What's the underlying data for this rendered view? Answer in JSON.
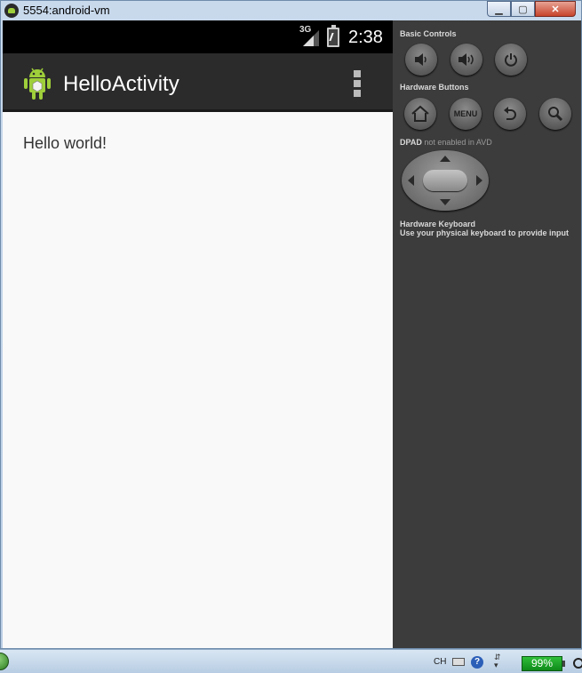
{
  "window": {
    "title": "5554:android-vm",
    "minimize_glyph": "▁",
    "maximize_glyph": "▢",
    "close_glyph": "✕"
  },
  "statusbar": {
    "network": "3G",
    "time": "2:38"
  },
  "actionbar": {
    "app_title": "HelloActivity",
    "app_icon": "android-robot-icon",
    "overflow_icon": "overflow-menu-icon"
  },
  "content": {
    "text": "Hello world!"
  },
  "panel": {
    "basic_controls_label": "Basic Controls",
    "basic_controls": [
      {
        "name": "volume-down",
        "glyph": "◀)"
      },
      {
        "name": "volume-up",
        "glyph": "◀))"
      },
      {
        "name": "power",
        "glyph": "⏻"
      }
    ],
    "hardware_buttons_label": "Hardware Buttons",
    "hardware_buttons": [
      {
        "name": "home",
        "glyph": "⌂"
      },
      {
        "name": "menu",
        "glyph": "MENU"
      },
      {
        "name": "back",
        "glyph": "↶"
      },
      {
        "name": "search",
        "glyph": "🔍"
      }
    ],
    "dpad_label": "DPAD",
    "dpad_note": "not enabled in AVD",
    "keyboard_label": "Hardware Keyboard",
    "keyboard_note": "Use your physical keyboard to provide input"
  },
  "taskbar": {
    "lang": "CH",
    "help_glyph": "?",
    "battery": "99%"
  },
  "colors": {
    "statusbar": "#000000",
    "actionbar": "#2b2b2b",
    "screen": "#f9f9f9",
    "panel": "#3c3c3c",
    "android_green": "#9fcf3a"
  }
}
